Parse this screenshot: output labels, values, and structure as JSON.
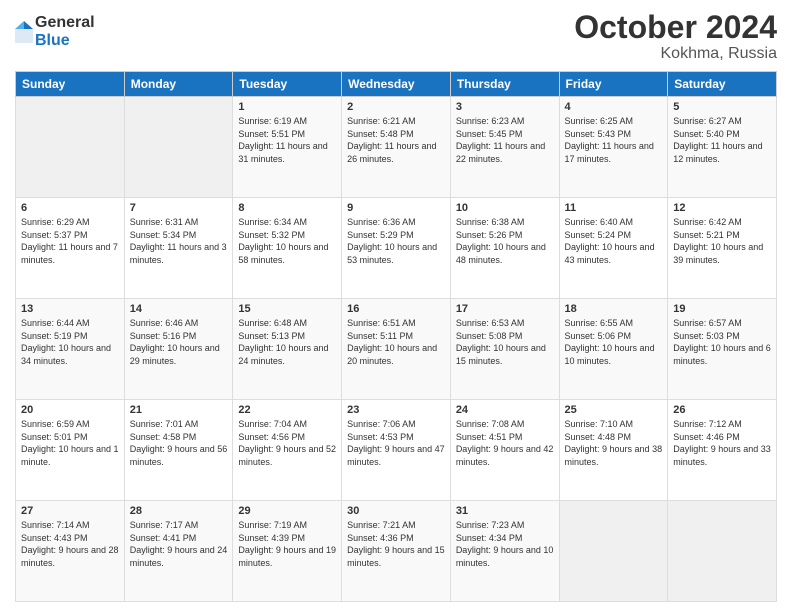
{
  "header": {
    "logo": {
      "general": "General",
      "blue": "Blue"
    },
    "title": "October 2024",
    "location": "Kokhma, Russia"
  },
  "weekdays": [
    "Sunday",
    "Monday",
    "Tuesday",
    "Wednesday",
    "Thursday",
    "Friday",
    "Saturday"
  ],
  "weeks": [
    [
      {
        "day": "",
        "sunrise": "",
        "sunset": "",
        "daylight": ""
      },
      {
        "day": "",
        "sunrise": "",
        "sunset": "",
        "daylight": ""
      },
      {
        "day": "1",
        "sunrise": "Sunrise: 6:19 AM",
        "sunset": "Sunset: 5:51 PM",
        "daylight": "Daylight: 11 hours and 31 minutes."
      },
      {
        "day": "2",
        "sunrise": "Sunrise: 6:21 AM",
        "sunset": "Sunset: 5:48 PM",
        "daylight": "Daylight: 11 hours and 26 minutes."
      },
      {
        "day": "3",
        "sunrise": "Sunrise: 6:23 AM",
        "sunset": "Sunset: 5:45 PM",
        "daylight": "Daylight: 11 hours and 22 minutes."
      },
      {
        "day": "4",
        "sunrise": "Sunrise: 6:25 AM",
        "sunset": "Sunset: 5:43 PM",
        "daylight": "Daylight: 11 hours and 17 minutes."
      },
      {
        "day": "5",
        "sunrise": "Sunrise: 6:27 AM",
        "sunset": "Sunset: 5:40 PM",
        "daylight": "Daylight: 11 hours and 12 minutes."
      }
    ],
    [
      {
        "day": "6",
        "sunrise": "Sunrise: 6:29 AM",
        "sunset": "Sunset: 5:37 PM",
        "daylight": "Daylight: 11 hours and 7 minutes."
      },
      {
        "day": "7",
        "sunrise": "Sunrise: 6:31 AM",
        "sunset": "Sunset: 5:34 PM",
        "daylight": "Daylight: 11 hours and 3 minutes."
      },
      {
        "day": "8",
        "sunrise": "Sunrise: 6:34 AM",
        "sunset": "Sunset: 5:32 PM",
        "daylight": "Daylight: 10 hours and 58 minutes."
      },
      {
        "day": "9",
        "sunrise": "Sunrise: 6:36 AM",
        "sunset": "Sunset: 5:29 PM",
        "daylight": "Daylight: 10 hours and 53 minutes."
      },
      {
        "day": "10",
        "sunrise": "Sunrise: 6:38 AM",
        "sunset": "Sunset: 5:26 PM",
        "daylight": "Daylight: 10 hours and 48 minutes."
      },
      {
        "day": "11",
        "sunrise": "Sunrise: 6:40 AM",
        "sunset": "Sunset: 5:24 PM",
        "daylight": "Daylight: 10 hours and 43 minutes."
      },
      {
        "day": "12",
        "sunrise": "Sunrise: 6:42 AM",
        "sunset": "Sunset: 5:21 PM",
        "daylight": "Daylight: 10 hours and 39 minutes."
      }
    ],
    [
      {
        "day": "13",
        "sunrise": "Sunrise: 6:44 AM",
        "sunset": "Sunset: 5:19 PM",
        "daylight": "Daylight: 10 hours and 34 minutes."
      },
      {
        "day": "14",
        "sunrise": "Sunrise: 6:46 AM",
        "sunset": "Sunset: 5:16 PM",
        "daylight": "Daylight: 10 hours and 29 minutes."
      },
      {
        "day": "15",
        "sunrise": "Sunrise: 6:48 AM",
        "sunset": "Sunset: 5:13 PM",
        "daylight": "Daylight: 10 hours and 24 minutes."
      },
      {
        "day": "16",
        "sunrise": "Sunrise: 6:51 AM",
        "sunset": "Sunset: 5:11 PM",
        "daylight": "Daylight: 10 hours and 20 minutes."
      },
      {
        "day": "17",
        "sunrise": "Sunrise: 6:53 AM",
        "sunset": "Sunset: 5:08 PM",
        "daylight": "Daylight: 10 hours and 15 minutes."
      },
      {
        "day": "18",
        "sunrise": "Sunrise: 6:55 AM",
        "sunset": "Sunset: 5:06 PM",
        "daylight": "Daylight: 10 hours and 10 minutes."
      },
      {
        "day": "19",
        "sunrise": "Sunrise: 6:57 AM",
        "sunset": "Sunset: 5:03 PM",
        "daylight": "Daylight: 10 hours and 6 minutes."
      }
    ],
    [
      {
        "day": "20",
        "sunrise": "Sunrise: 6:59 AM",
        "sunset": "Sunset: 5:01 PM",
        "daylight": "Daylight: 10 hours and 1 minute."
      },
      {
        "day": "21",
        "sunrise": "Sunrise: 7:01 AM",
        "sunset": "Sunset: 4:58 PM",
        "daylight": "Daylight: 9 hours and 56 minutes."
      },
      {
        "day": "22",
        "sunrise": "Sunrise: 7:04 AM",
        "sunset": "Sunset: 4:56 PM",
        "daylight": "Daylight: 9 hours and 52 minutes."
      },
      {
        "day": "23",
        "sunrise": "Sunrise: 7:06 AM",
        "sunset": "Sunset: 4:53 PM",
        "daylight": "Daylight: 9 hours and 47 minutes."
      },
      {
        "day": "24",
        "sunrise": "Sunrise: 7:08 AM",
        "sunset": "Sunset: 4:51 PM",
        "daylight": "Daylight: 9 hours and 42 minutes."
      },
      {
        "day": "25",
        "sunrise": "Sunrise: 7:10 AM",
        "sunset": "Sunset: 4:48 PM",
        "daylight": "Daylight: 9 hours and 38 minutes."
      },
      {
        "day": "26",
        "sunrise": "Sunrise: 7:12 AM",
        "sunset": "Sunset: 4:46 PM",
        "daylight": "Daylight: 9 hours and 33 minutes."
      }
    ],
    [
      {
        "day": "27",
        "sunrise": "Sunrise: 7:14 AM",
        "sunset": "Sunset: 4:43 PM",
        "daylight": "Daylight: 9 hours and 28 minutes."
      },
      {
        "day": "28",
        "sunrise": "Sunrise: 7:17 AM",
        "sunset": "Sunset: 4:41 PM",
        "daylight": "Daylight: 9 hours and 24 minutes."
      },
      {
        "day": "29",
        "sunrise": "Sunrise: 7:19 AM",
        "sunset": "Sunset: 4:39 PM",
        "daylight": "Daylight: 9 hours and 19 minutes."
      },
      {
        "day": "30",
        "sunrise": "Sunrise: 7:21 AM",
        "sunset": "Sunset: 4:36 PM",
        "daylight": "Daylight: 9 hours and 15 minutes."
      },
      {
        "day": "31",
        "sunrise": "Sunrise: 7:23 AM",
        "sunset": "Sunset: 4:34 PM",
        "daylight": "Daylight: 9 hours and 10 minutes."
      },
      {
        "day": "",
        "sunrise": "",
        "sunset": "",
        "daylight": ""
      },
      {
        "day": "",
        "sunrise": "",
        "sunset": "",
        "daylight": ""
      }
    ]
  ]
}
